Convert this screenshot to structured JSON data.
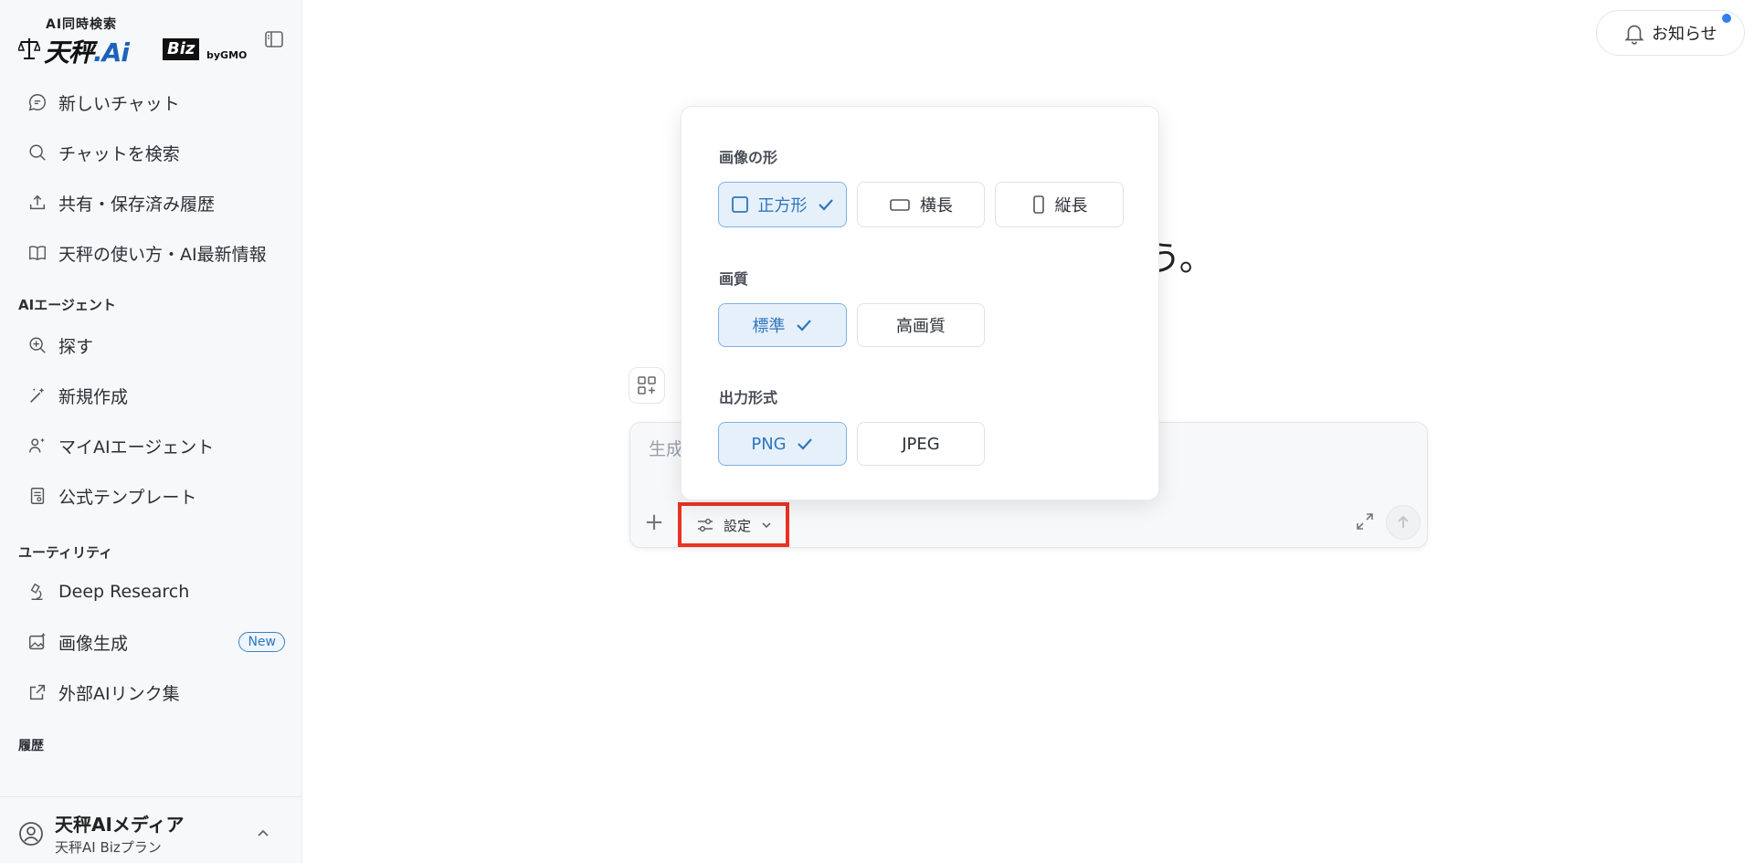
{
  "brand": {
    "subtitle": "AI同時検索",
    "name_part1": "天秤",
    "name_part2": ".Ai",
    "badge": "Biz",
    "by": "byGMO"
  },
  "sidebar": {
    "top_items": [
      {
        "label": "新しいチャット",
        "icon": "chat-bubble-icon"
      },
      {
        "label": "チャットを検索",
        "icon": "search-icon"
      },
      {
        "label": "共有・保存済み履歴",
        "icon": "share-upload-icon"
      },
      {
        "label": "天秤の使い方・AI最新情報",
        "icon": "book-icon"
      }
    ],
    "agent_section_title": "AIエージェント",
    "agent_items": [
      {
        "label": "探す",
        "icon": "zoom-plus-icon"
      },
      {
        "label": "新規作成",
        "icon": "magic-pen-icon"
      },
      {
        "label": "マイAIエージェント",
        "icon": "user-sparkle-icon"
      },
      {
        "label": "公式テンプレート",
        "icon": "template-document-icon"
      }
    ],
    "utility_section_title": "ユーティリティ",
    "utility_items": [
      {
        "label": "Deep Research",
        "icon": "microscope-icon"
      },
      {
        "label": "画像生成",
        "icon": "image-sparkle-icon",
        "badge": "New"
      },
      {
        "label": "外部AIリンク集",
        "icon": "external-link-icon"
      }
    ],
    "history_section_title": "履歴"
  },
  "user": {
    "name": "天秤AIメディア",
    "plan": "天秤AI Bizプラン"
  },
  "header": {
    "notice_label": "お知らせ"
  },
  "main": {
    "hero_fragment": "う。"
  },
  "composer": {
    "placeholder": "生成",
    "plus_label": "+",
    "settings_label": "設定"
  },
  "popover": {
    "shape_title": "画像の形",
    "shape_options": [
      {
        "label": "正方形",
        "selected": true
      },
      {
        "label": "横長",
        "selected": false
      },
      {
        "label": "縦長",
        "selected": false
      }
    ],
    "quality_title": "画質",
    "quality_options": [
      {
        "label": "標準",
        "selected": true
      },
      {
        "label": "高画質",
        "selected": false
      }
    ],
    "format_title": "出力形式",
    "format_options": [
      {
        "label": "PNG",
        "selected": true
      },
      {
        "label": "JPEG",
        "selected": false
      }
    ]
  },
  "colors": {
    "accent": "#2f76bd",
    "selected_bg": "#e6f0fb",
    "highlight": "#ea3323",
    "notice_dot": "#2f80ed"
  }
}
